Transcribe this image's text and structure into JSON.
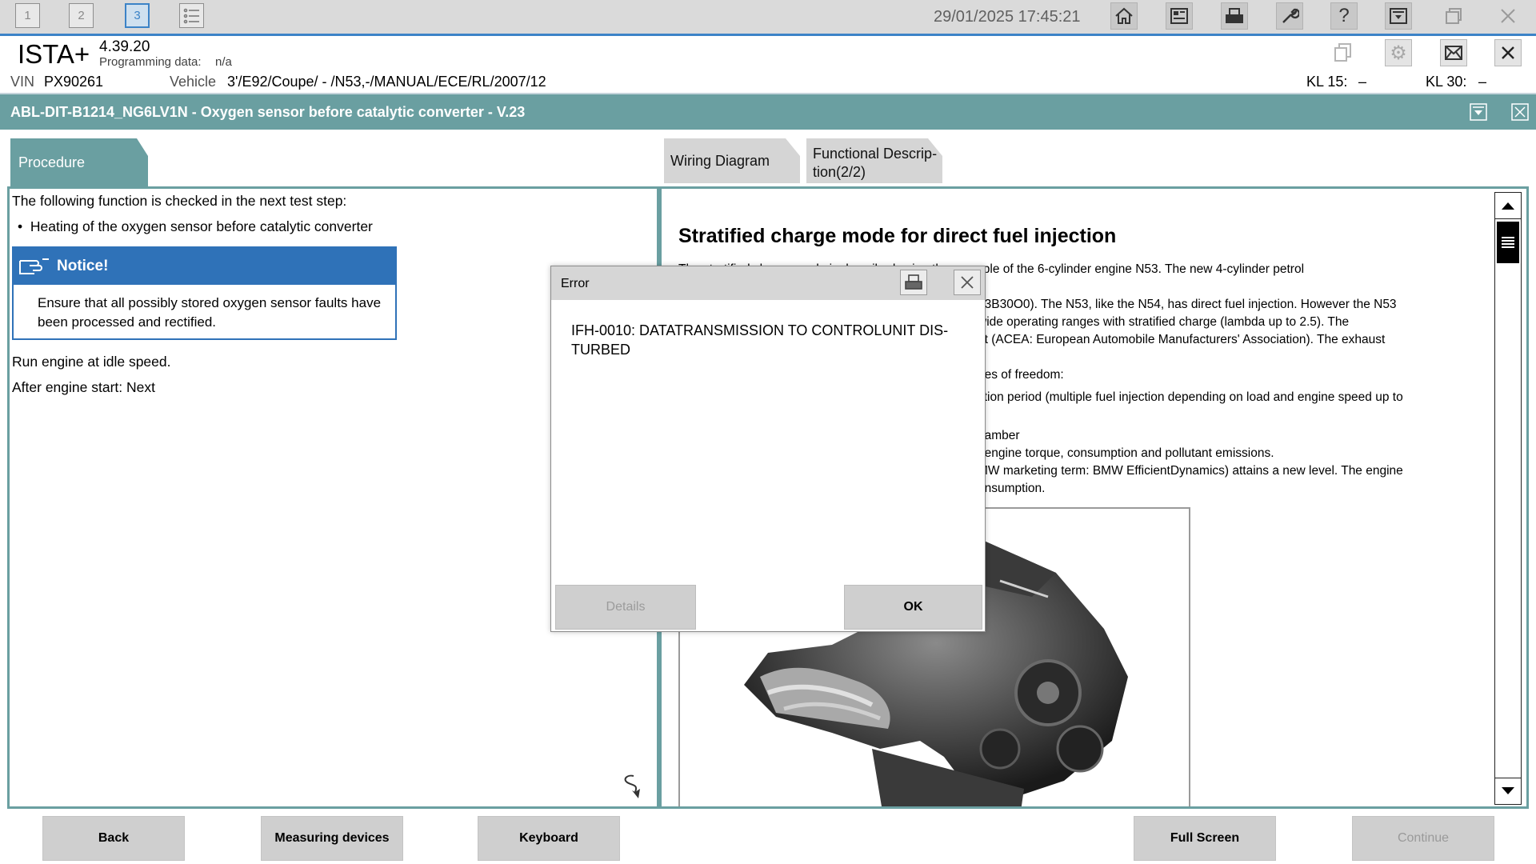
{
  "window_tabs": [
    "1",
    "2",
    "3"
  ],
  "datetime": "29/01/2025 17:45:21",
  "header": {
    "app_name": "ISTA+",
    "version": "4.39.20",
    "programming_label": "Programming data:",
    "programming_value": "n/a"
  },
  "vehicle_bar": {
    "vin_label": "VIN",
    "vin_value": "PX90261",
    "vehicle_label": "Vehicle",
    "vehicle_value": "3'/E92/Coupe/ - /N53,-/MANUAL/ECE/RL/2007/12",
    "kl15_label": "KL 15:",
    "kl15_value": "–",
    "kl30_label": "KL 30:",
    "kl30_value": "–"
  },
  "test_title": "ABL-DIT-B1214_NG6LV1N - Oxygen sensor before catalytic converter - V.23",
  "tabs": {
    "procedure": "Procedure",
    "wiring": "Wiring Diagram",
    "functional_line1": "Functional Descrip-",
    "functional_line2": "tion(2/2)"
  },
  "procedure": {
    "intro": "The following function is checked in the next test step:",
    "bullet": "Heating of the oxygen sensor before catalytic converter",
    "notice_title": "Notice!",
    "notice_text": "Ensure that all possibly stored oxygen sensor faults have been processed and rectified.",
    "step1": "Run engine at idle speed.",
    "step2": "After engine start: Next"
  },
  "functional_description": {
    "heading": "Stratified charge mode for direct fuel injection",
    "lines": [
      "The stratified charge mode is described using the example of the 6-cylinder engine N53. The new 4-cylinder petrol",
      "53B30O0). The N53, like the N54, has direct fuel injection. However the N53",
      "wide operating ranges with stratified charge (lambda up to 2.5). The",
      "et (ACEA: European Automobile Manufacturers' Association). The exhaust",
      "ees of freedom:",
      "ction period (multiple fuel injection depending on load and engine speed up to",
      "hamber",
      ", engine torque, consumption and pollutant emissions.",
      "MW marketing term: BMW EfficientDynamics) attains a new level. The engine",
      "onsumption."
    ]
  },
  "dialog": {
    "title": "Error",
    "message": "IFH-0010: DATATRANSMISSION TO CONTROLUNIT DIS-TURBED",
    "details_label": "Details",
    "ok_label": "OK"
  },
  "bottom_buttons": {
    "back": "Back",
    "measuring": "Measuring devices",
    "keyboard": "Keyboard",
    "fullscreen": "Full Screen",
    "continue": "Continue"
  }
}
